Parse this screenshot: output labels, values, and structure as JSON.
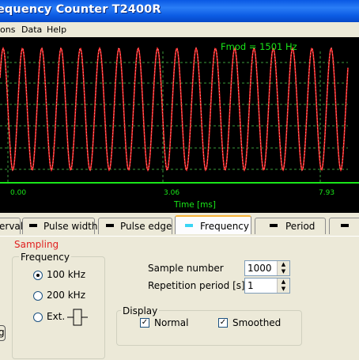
{
  "window": {
    "title": "equency Counter T2400R"
  },
  "menu": {
    "items": [
      "ons",
      "Data",
      "Help"
    ]
  },
  "scope": {
    "fmod_label": "Fmod = 1501 Hz",
    "x_ticks": [
      "0.00",
      "3.06",
      "7.93"
    ],
    "x_axis_label": "Time [ms]",
    "colors": {
      "signal": "#ff2a2a",
      "grid": "#3c9a3c",
      "axis": "#19e619",
      "text": "#19e619"
    }
  },
  "tabs": [
    {
      "label": "erval",
      "active": false
    },
    {
      "label": "Pulse width",
      "active": false
    },
    {
      "label": "Pulse edge",
      "active": false
    },
    {
      "label": "Frequency",
      "active": true
    },
    {
      "label": "Period",
      "active": false
    }
  ],
  "sampling": {
    "title": "Sampling",
    "frequency_title": "Frequency",
    "options": [
      "100 kHz",
      "200 kHz",
      "Ext."
    ],
    "selected": "100 kHz",
    "sample_number_label": "Sample number",
    "sample_number_value": "1000",
    "repetition_label": "Repetition period [s]",
    "repetition_value": "1",
    "display_title": "Display",
    "normal_label": "Normal",
    "normal_checked": true,
    "smoothed_label": "Smoothed",
    "smoothed_checked": true,
    "left_edge_label": "g"
  }
}
